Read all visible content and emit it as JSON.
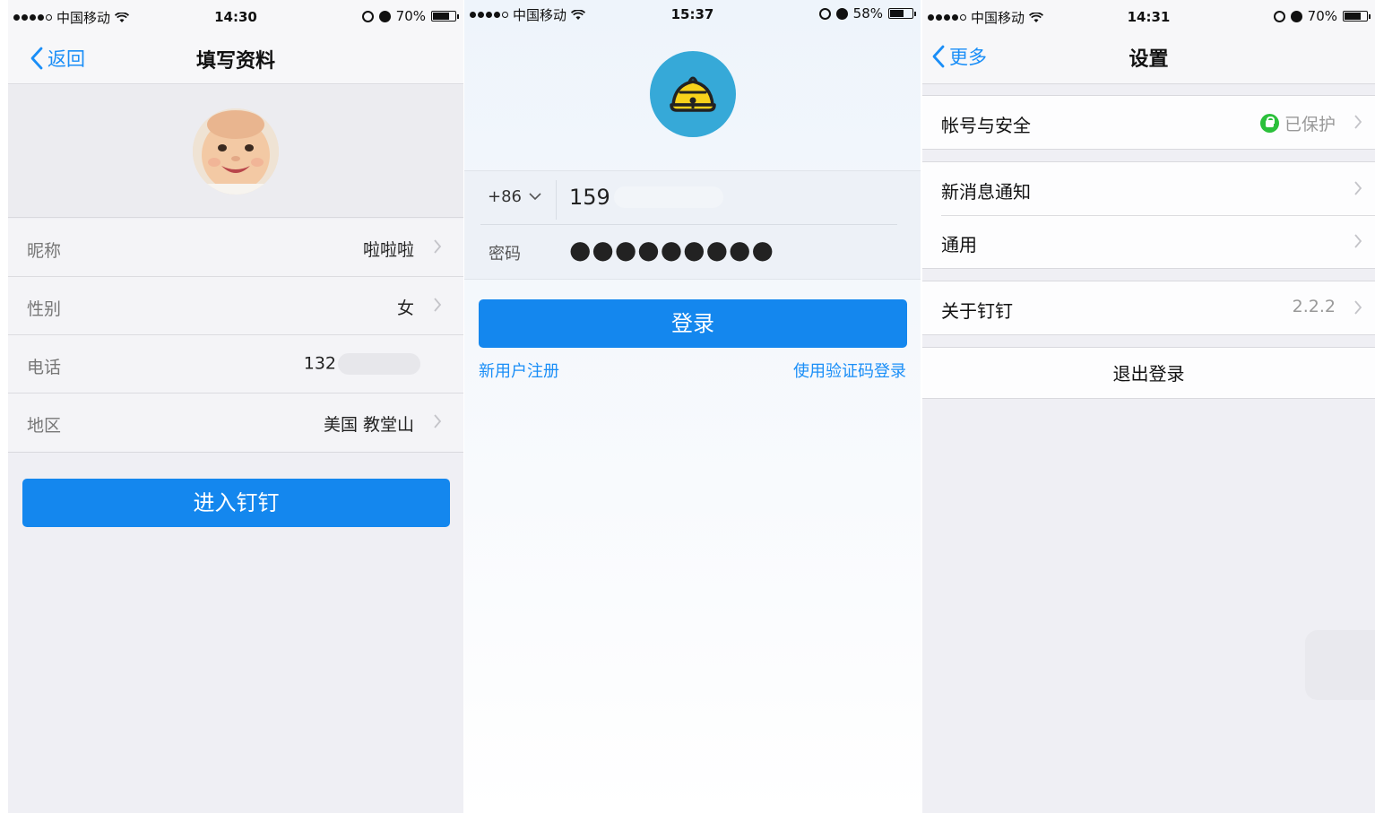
{
  "screen1": {
    "status": {
      "carrier": "中国移动",
      "time": "14:30",
      "battery": "70%"
    },
    "nav": {
      "back_label": "返回",
      "title": "填写资料"
    },
    "rows": [
      {
        "label": "昵称",
        "value": "啦啦啦"
      },
      {
        "label": "性别",
        "value": "女"
      },
      {
        "label": "电话",
        "value": "132"
      },
      {
        "label": "地区",
        "value": "美国 教堂山"
      }
    ],
    "button_label": "进入钉钉"
  },
  "screen2": {
    "status": {
      "carrier": "中国移动",
      "time": "15:37",
      "battery": "58%"
    },
    "country_code": "+86",
    "phone_value": "159",
    "password_label": "密码",
    "password_mask": "●●●●●●●●●",
    "login_label": "登录",
    "register_link": "新用户注册",
    "sms_login_link": "使用验证码登录"
  },
  "screen3": {
    "status": {
      "carrier": "中国移动",
      "time": "14:31",
      "battery": "70%"
    },
    "nav": {
      "back_label": "更多",
      "title": "设置"
    },
    "account_label": "帐号与安全",
    "account_status": "已保护",
    "notify_label": "新消息通知",
    "general_label": "通用",
    "about_label": "关于钉钉",
    "version": "2.2.2",
    "logout_label": "退出登录"
  },
  "colors": {
    "accent": "#1487ee",
    "link": "#1a8ef7",
    "protected": "#2bc03b",
    "logo_bg": "#36a9d8"
  }
}
